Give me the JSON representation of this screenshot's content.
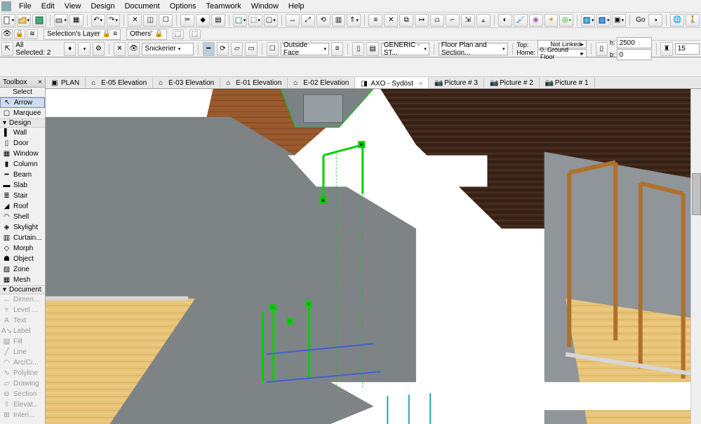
{
  "menu": [
    "File",
    "Edit",
    "View",
    "Design",
    "Document",
    "Options",
    "Teamwork",
    "Window",
    "Help"
  ],
  "sel_row": {
    "selections_layer": "Selection's Layer",
    "others": "Others'"
  },
  "status_selected": "All Selected: 2",
  "prop": {
    "layer": "Snickerier",
    "face": "Outside Face",
    "generic": "GENERIC - ST...",
    "fp_label": "Floor Plan and Section...",
    "top": "Top:",
    "home": "Home:",
    "not_linked": "Not Linked",
    "ground": "0. Ground Floor",
    "h_label": "h:",
    "b_label": "b:",
    "h_val": "2500",
    "b_val": "0",
    "extra_val": "15"
  },
  "go_label": "Go",
  "toolbox": {
    "title": "Toolbox",
    "select": "Select",
    "arrow": "Arrow",
    "marquee": "Marquee",
    "design": "Design",
    "wall": "Wall",
    "door": "Door",
    "window": "Window",
    "column": "Column",
    "beam": "Beam",
    "slab": "Slab",
    "stair": "Stair",
    "roof": "Roof",
    "shell": "Shell",
    "skylight": "Skylight",
    "curtain": "Curtain...",
    "morph": "Morph",
    "object": "Object",
    "zone": "Zone",
    "mesh": "Mesh",
    "document": "Document",
    "dimen": "Dimen...",
    "level": "Level ...",
    "text": "Text",
    "label": "Label",
    "fill": "Fill",
    "line": "Line",
    "arc": "Arc/Ci...",
    "polyline": "Polyline",
    "drawing": "Drawing",
    "section": "Section",
    "elevat": "Elevat...",
    "interi": "Interi..."
  },
  "tabs": [
    {
      "label": "PLAN",
      "icon": "plan"
    },
    {
      "label": "E-05 Elevation",
      "icon": "elev"
    },
    {
      "label": "E-03 Elevation",
      "icon": "elev"
    },
    {
      "label": "E-01 Elevation",
      "icon": "elev"
    },
    {
      "label": "E-02 Elevation",
      "icon": "elev"
    },
    {
      "label": "AXO - Sydöst",
      "icon": "axo",
      "active": true
    },
    {
      "label": "Picture # 3",
      "icon": "pic"
    },
    {
      "label": "Picture # 2",
      "icon": "pic"
    },
    {
      "label": "Picture # 1",
      "icon": "pic"
    }
  ]
}
